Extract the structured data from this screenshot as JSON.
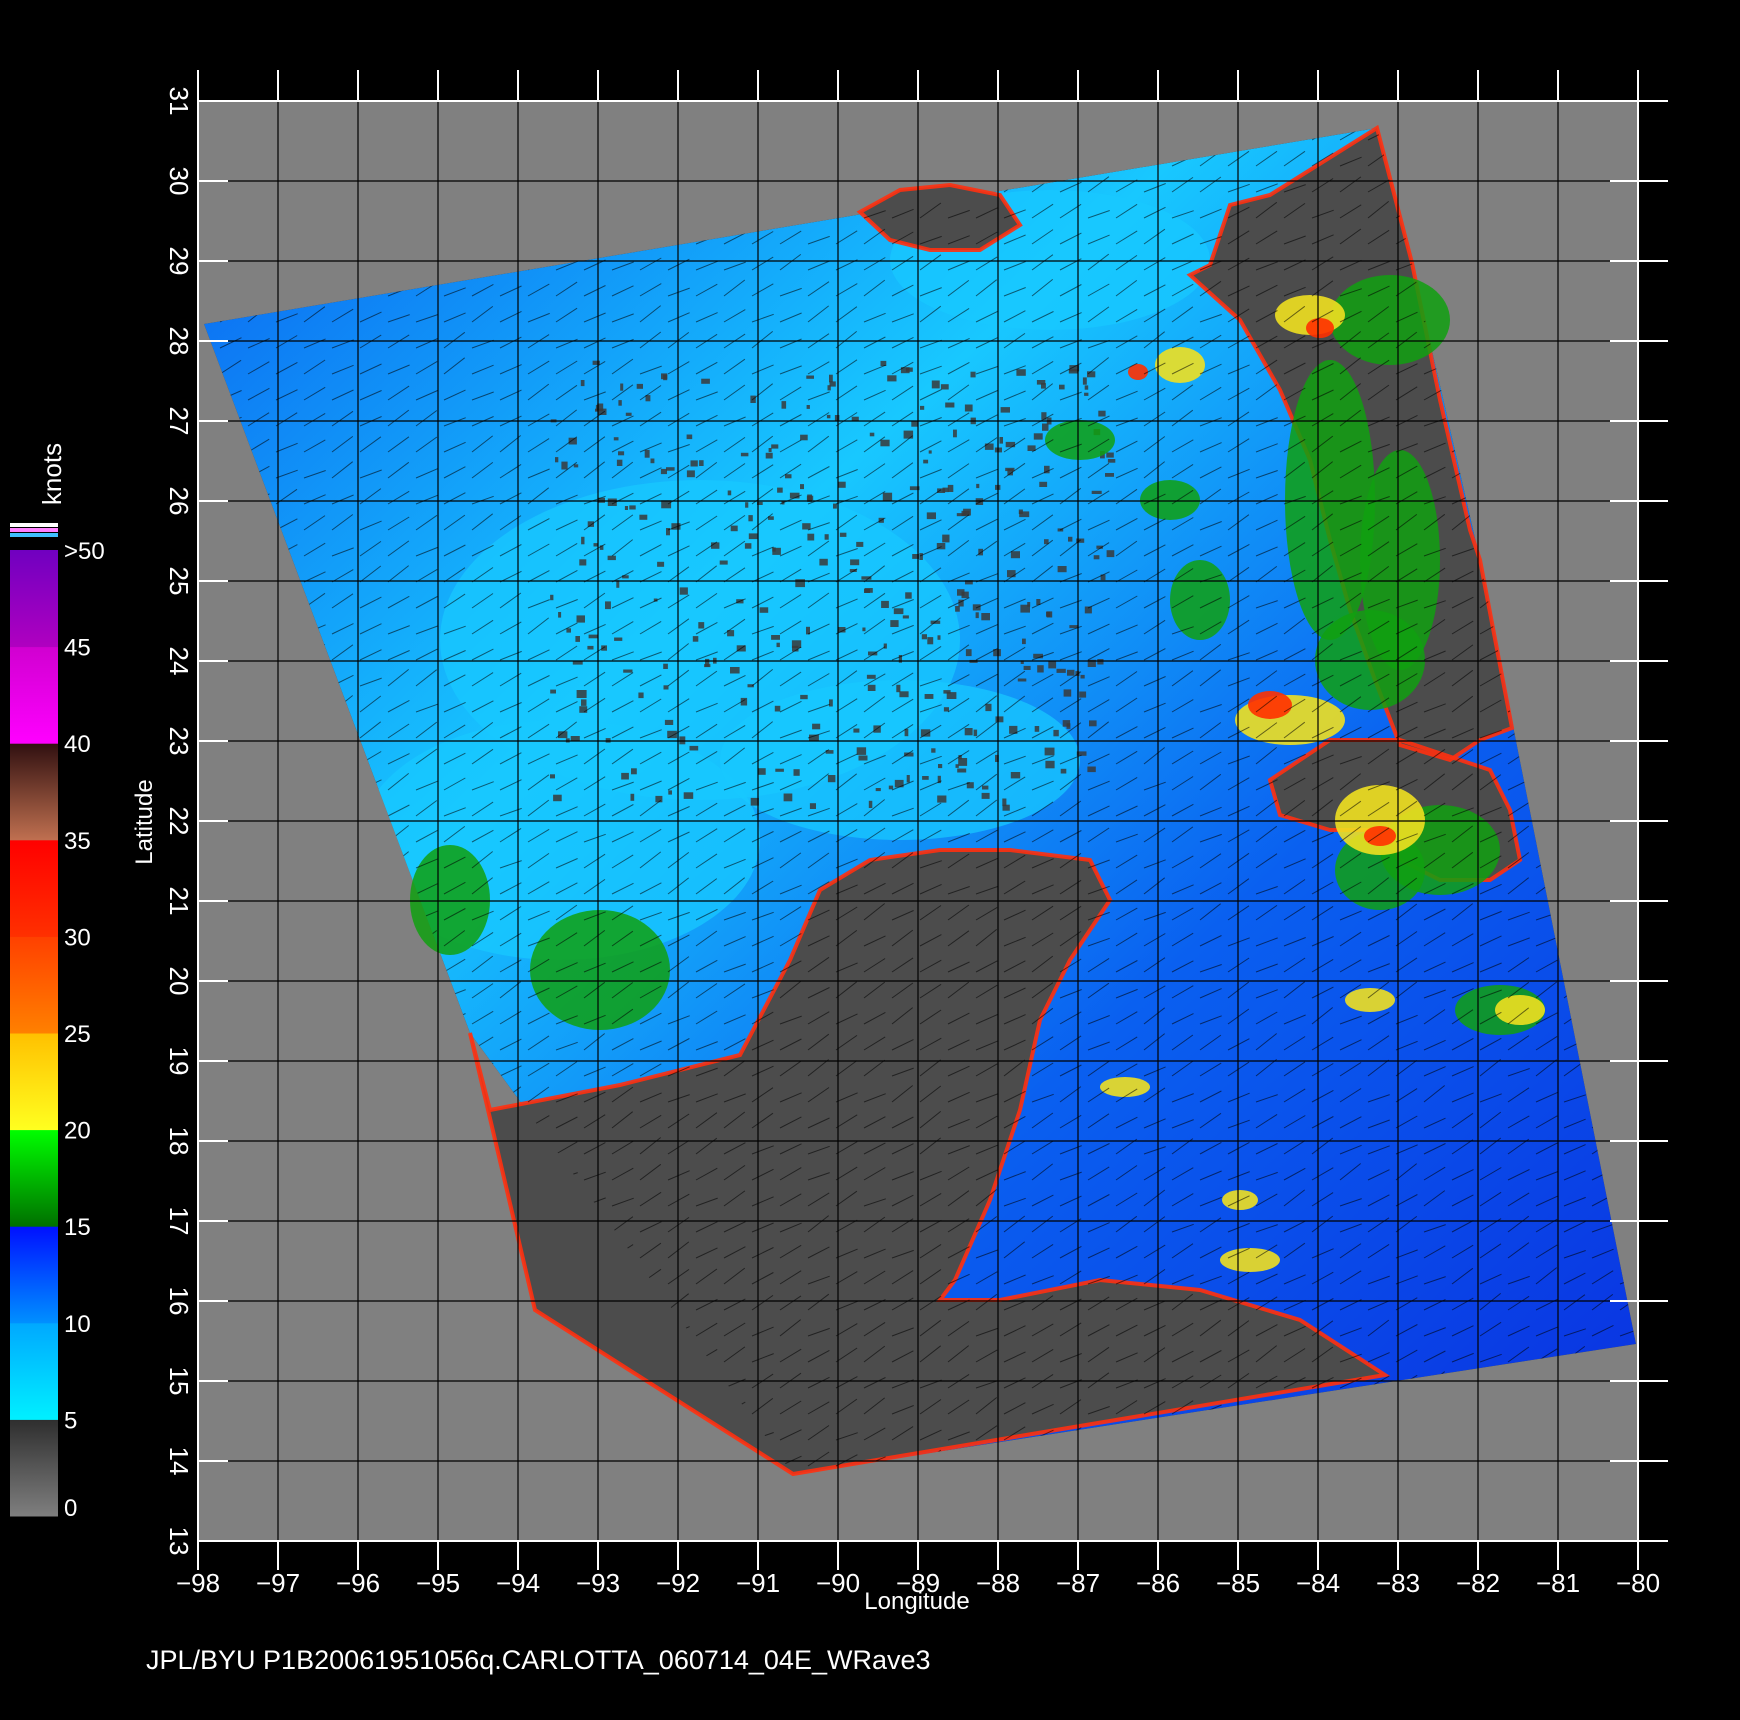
{
  "chart_data": {
    "type": "heatmap",
    "title": "",
    "xlabel": "Longitude",
    "ylabel": "Latitude",
    "xlim": [
      -98,
      -80
    ],
    "ylim": [
      13,
      31
    ],
    "x_ticks": [
      "-98",
      "-97",
      "-96",
      "-95",
      "-94",
      "-93",
      "-92",
      "-91",
      "-90",
      "-89",
      "-88",
      "-87",
      "-86",
      "-85",
      "-84",
      "-83",
      "-82",
      "-81",
      "-80"
    ],
    "y_ticks": [
      "13",
      "14",
      "15",
      "16",
      "17",
      "18",
      "19",
      "20",
      "21",
      "22",
      "23",
      "24",
      "25",
      "26",
      "27",
      "28",
      "29",
      "30",
      "31"
    ],
    "grid": true,
    "colorbar": {
      "label": "knots",
      "ticks": [
        "0",
        "5",
        "10",
        "15",
        "20",
        "25",
        "30",
        "35",
        "40",
        "45",
        ">50"
      ],
      "bands": [
        {
          "from": 0,
          "to": 5,
          "colors": [
            "#7f7f7f",
            "#2e2e2e"
          ]
        },
        {
          "from": 5,
          "to": 10,
          "colors": [
            "#00f0ff",
            "#00a8ff"
          ]
        },
        {
          "from": 10,
          "to": 15,
          "colors": [
            "#0090ff",
            "#0010ff"
          ]
        },
        {
          "from": 15,
          "to": 20,
          "colors": [
            "#007000",
            "#00ff00"
          ]
        },
        {
          "from": 20,
          "to": 25,
          "colors": [
            "#ffff20",
            "#ffc000"
          ]
        },
        {
          "from": 25,
          "to": 30,
          "colors": [
            "#ff8000",
            "#ff4000"
          ]
        },
        {
          "from": 30,
          "to": 35,
          "colors": [
            "#ff3000",
            "#ff0000"
          ]
        },
        {
          "from": 35,
          "to": 40,
          "colors": [
            "#c07050",
            "#301010"
          ]
        },
        {
          "from": 40,
          "to": 45,
          "colors": [
            "#ff00ff",
            "#d000d0"
          ]
        },
        {
          "from": 45,
          "to": 50,
          "colors": [
            "#b000c0",
            "#7000c0"
          ]
        }
      ],
      "over_colors": [
        "#ffffff",
        "#ff80ff",
        "#40c0ff"
      ]
    },
    "colors": {
      "background": "#000000",
      "no_data": "#808080",
      "land": "#4c4c4c",
      "ocean_low": "#18c8ff",
      "ocean_mid": "#0a60f0",
      "ocean_deep": "#0a30e0",
      "moderate_wind": "#11a011",
      "strong_wind": "#f0e020",
      "gale": "#ff3000",
      "coast_fringe": "#ff3010",
      "grid": "#000000",
      "wind_barb": "#000000",
      "text": "#ffffff"
    }
  },
  "footer": {
    "source_text": "JPL/BYU  P1B20061951056q.CARLOTTA_060714_04E_WRave3"
  }
}
